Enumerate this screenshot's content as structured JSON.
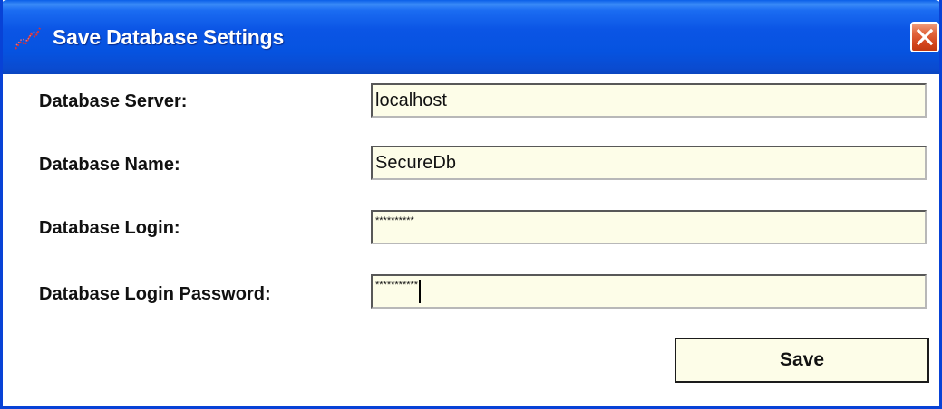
{
  "window": {
    "title": "Save Database Settings",
    "app_icon": "chart-icon",
    "close_icon": "close-icon"
  },
  "form": {
    "fields": [
      {
        "label": "Database Server:",
        "value": "localhost",
        "masked": false
      },
      {
        "label": "Database Name:",
        "value": "SecureDb",
        "masked": false
      },
      {
        "label": "Database Login:",
        "value": "**********",
        "masked": true
      },
      {
        "label": "Database Login Password:",
        "value": "***********",
        "masked": true,
        "focused": true
      }
    ],
    "save_label": "Save"
  },
  "colors": {
    "titlebar": "#0653e0",
    "window_border": "#0842d6",
    "input_background": "#fdfde8",
    "close_button": "#d2441c"
  }
}
